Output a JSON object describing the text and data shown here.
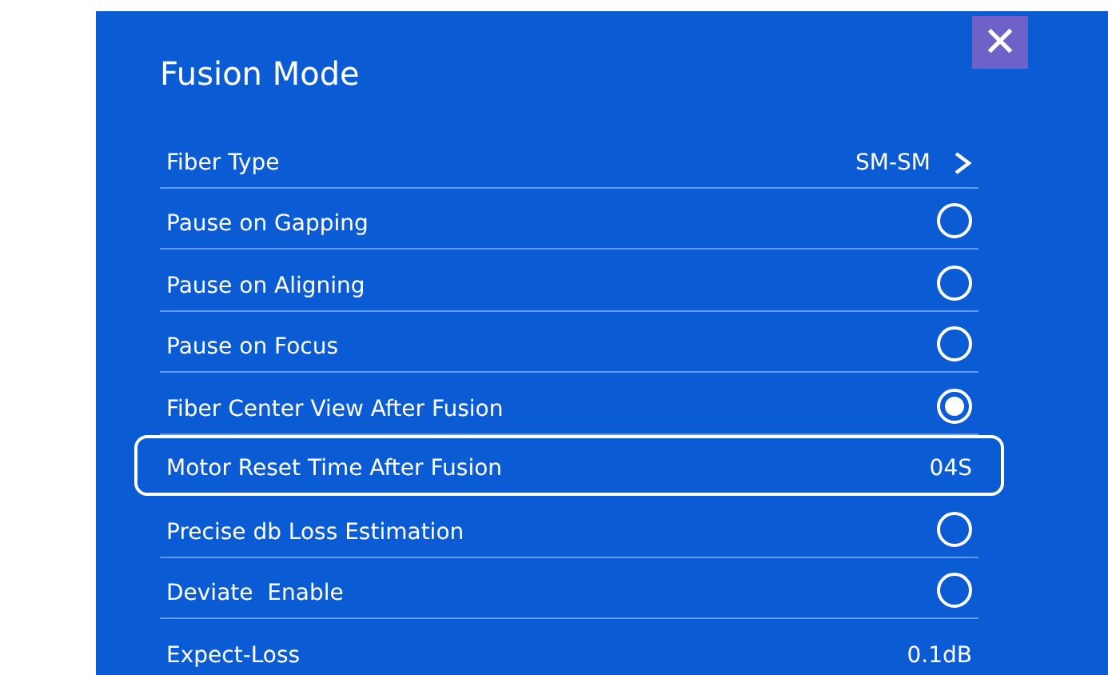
{
  "dialog": {
    "title": "Fusion Mode",
    "close": "✕"
  },
  "rows": [
    {
      "kind": "link",
      "label": "Fiber Type",
      "value": "SM-SM",
      "selected": false
    },
    {
      "kind": "radio",
      "label": "Pause on Gapping",
      "checked": false,
      "selected": false
    },
    {
      "kind": "radio",
      "label": "Pause on Aligning",
      "checked": false,
      "selected": false
    },
    {
      "kind": "radio",
      "label": "Pause on Focus",
      "checked": false,
      "selected": false
    },
    {
      "kind": "radio",
      "label": "Fiber Center View After Fusion",
      "checked": true,
      "selected": false
    },
    {
      "kind": "value",
      "label": "Motor Reset Time After Fusion",
      "value": "04S",
      "selected": true
    },
    {
      "kind": "radio",
      "label": "Precise db Loss Estimation",
      "checked": false,
      "selected": false
    },
    {
      "kind": "radio",
      "label": "Deviate  Enable",
      "checked": false,
      "selected": false
    },
    {
      "kind": "value",
      "label": "Expect-Loss",
      "value": "0.1dB",
      "selected": false
    }
  ]
}
